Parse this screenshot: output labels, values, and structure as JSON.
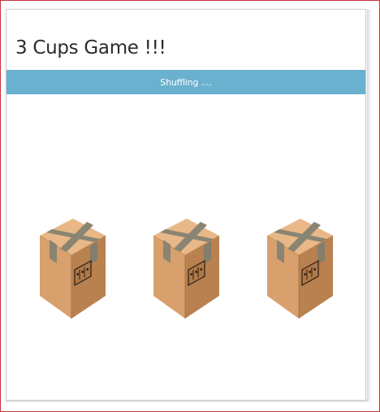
{
  "game": {
    "title": "3 Cups Game !!!",
    "status": "Shuffling ...."
  },
  "cups": [
    {
      "id": 1,
      "icon": "cardboard-box-icon"
    },
    {
      "id": 2,
      "icon": "cardboard-box-icon"
    },
    {
      "id": 3,
      "icon": "cardboard-box-icon"
    }
  ],
  "colors": {
    "frame_border": "#c8323c",
    "status_bar": "#69b1cf",
    "status_text": "#ffffff",
    "title_text": "#2b2b2b",
    "box_top": "#e8b889",
    "box_left": "#d8a06c",
    "box_right": "#b98050",
    "tape": "#8a8572"
  }
}
